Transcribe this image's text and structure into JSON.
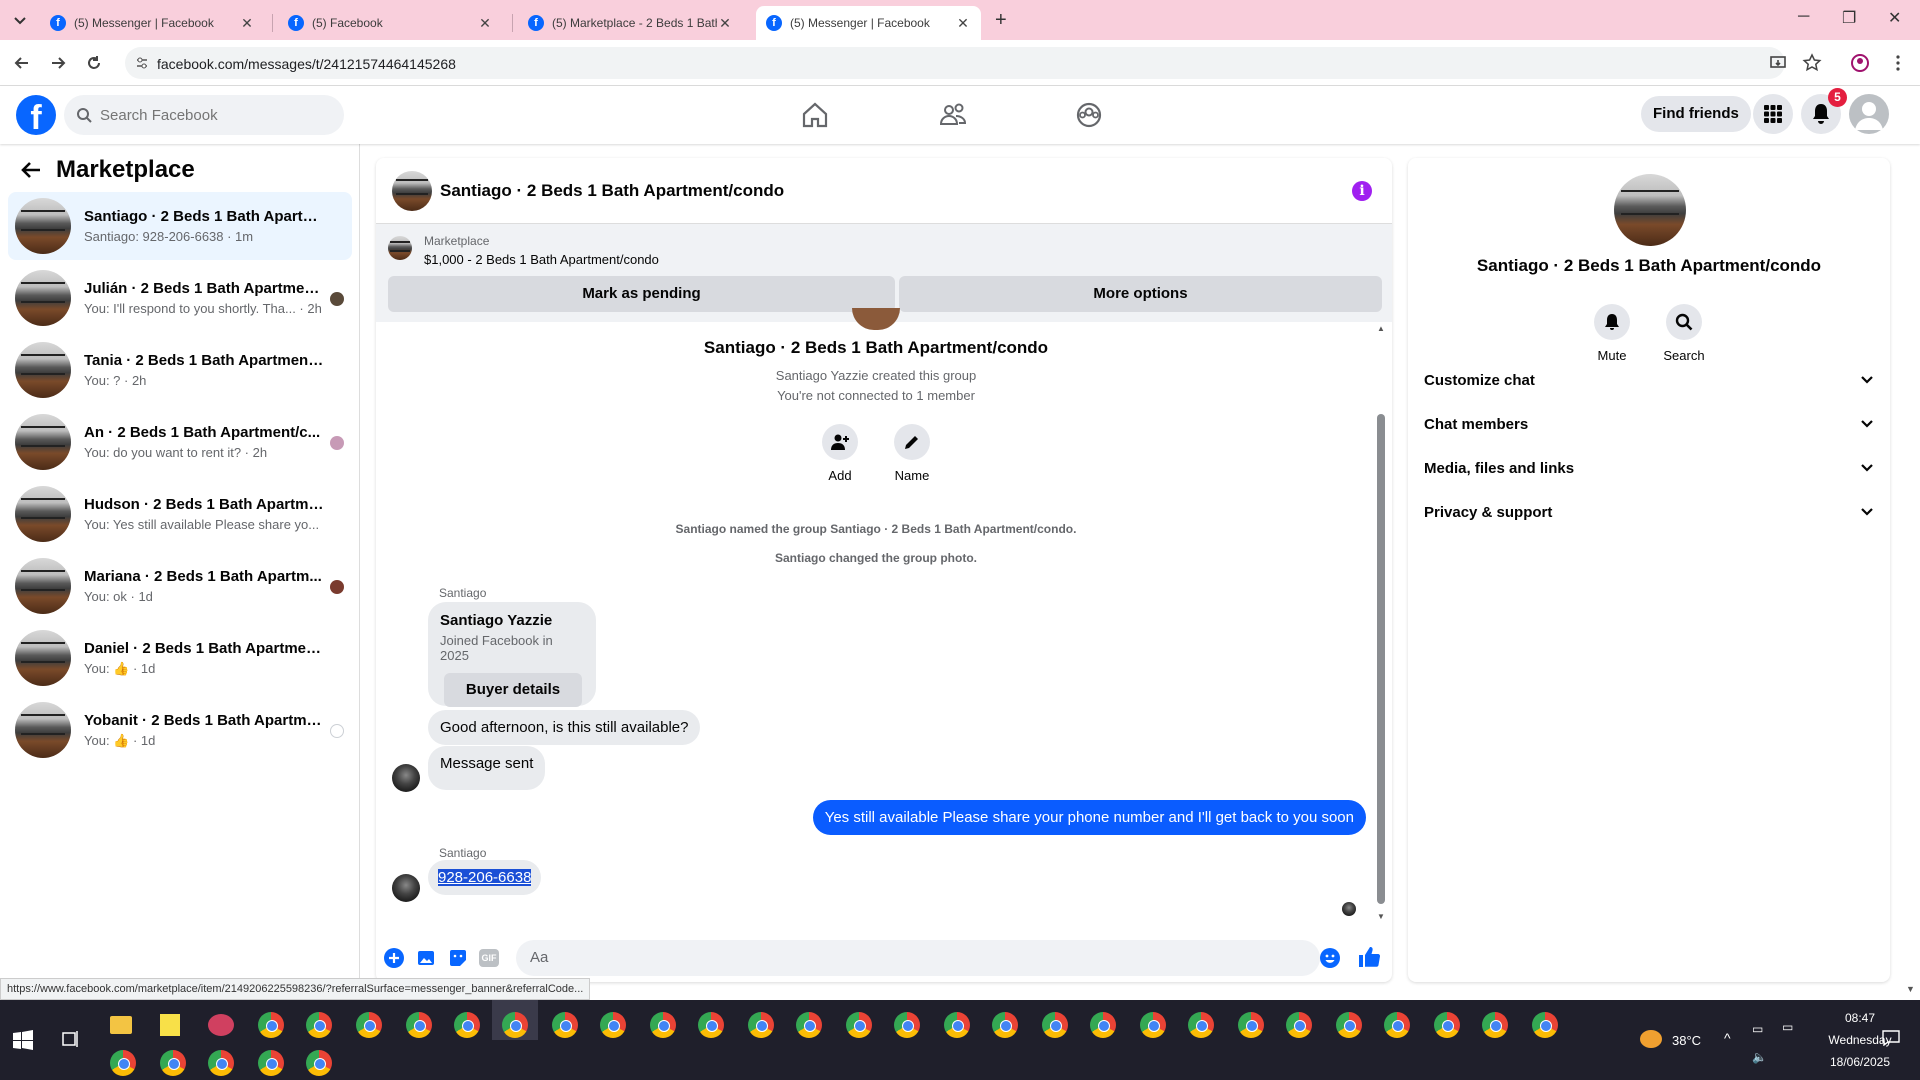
{
  "browser": {
    "tabs": [
      {
        "title": "(5) Messenger | Facebook"
      },
      {
        "title": "(5) Facebook"
      },
      {
        "title": "(5) Marketplace - 2 Beds 1 Bath"
      },
      {
        "title": "(5) Messenger | Facebook"
      }
    ],
    "url": "facebook.com/messages/t/24121574464145268",
    "status_url": "https://www.facebook.com/marketplace/item/2149206225598236/?referralSurface=messenger_banner&referralCode..."
  },
  "header": {
    "search_placeholder": "Search Facebook",
    "find_friends": "Find friends",
    "notification_count": "5"
  },
  "sidebar": {
    "title": "Marketplace",
    "conversations": [
      {
        "name": "Santiago · 2 Beds 1 Bath Apartmen...",
        "preview": "Santiago: 928-206-6638 · 1m"
      },
      {
        "name": "Julián · 2 Beds 1 Bath Apartment...",
        "preview": "You: I'll respond to you shortly. Tha... · 2h"
      },
      {
        "name": "Tania · 2 Beds 1 Bath Apartment/c...",
        "preview": "You: ? · 2h"
      },
      {
        "name": "An · 2 Beds 1 Bath Apartment/c...",
        "preview": "You: do you want to rent it? · 2h"
      },
      {
        "name": "Hudson · 2 Beds 1 Bath Apartment...",
        "preview": "You: Yes still available Please share yo... · 2h"
      },
      {
        "name": "Mariana · 2 Beds 1 Bath Apartm...",
        "preview": "You: ok · 1d"
      },
      {
        "name": "Daniel · 2 Beds 1 Bath Apartment/...",
        "preview": "You: 👍 · 1d"
      },
      {
        "name": "Yobanit · 2 Beds 1 Bath Apartme...",
        "preview": "You: 👍 · 1d"
      }
    ]
  },
  "chat": {
    "title": "Santiago · 2 Beds 1 Bath Apartment/condo",
    "banner_label": "Marketplace",
    "banner_price": "$1,000 - 2 Beds 1 Bath Apartment/condo",
    "mark_pending": "Mark as pending",
    "more_options": "More options",
    "group_title": "Santiago · 2 Beds 1 Bath Apartment/condo",
    "created_by": "Santiago Yazzie created this group",
    "not_connected": "You're not connected to 1 member",
    "add_label": "Add",
    "name_label": "Name",
    "event_named": "Santiago named the group Santiago · 2 Beds 1 Bath Apartment/condo.",
    "event_photo": "Santiago changed the group photo.",
    "sender1": "Santiago",
    "card_name": "Santiago Yazzie",
    "card_joined": "Joined Facebook in 2025",
    "buyer_details": "Buyer details",
    "msg_greeting": "Good afternoon, is this still available?",
    "msg_sent": "Message sent",
    "msg_reply": "Yes still available Please share your phone number and I'll get back to you soon",
    "sender2": "Santiago",
    "msg_phone": "928-206-6638",
    "composer_placeholder": "Aa"
  },
  "details": {
    "title": "Santiago · 2 Beds 1 Bath Apartment/condo",
    "mute": "Mute",
    "search": "Search",
    "sections": [
      "Customize chat",
      "Chat members",
      "Media, files and links",
      "Privacy & support"
    ]
  },
  "taskbar": {
    "temperature": "38°C",
    "time": "08:47",
    "day": "Wednesday",
    "date": "18/06/2025"
  },
  "colors": {
    "brand": "#0866ff",
    "outgoing_bubble": "#0a5cff",
    "tab_bar": "#f9cfdc"
  }
}
